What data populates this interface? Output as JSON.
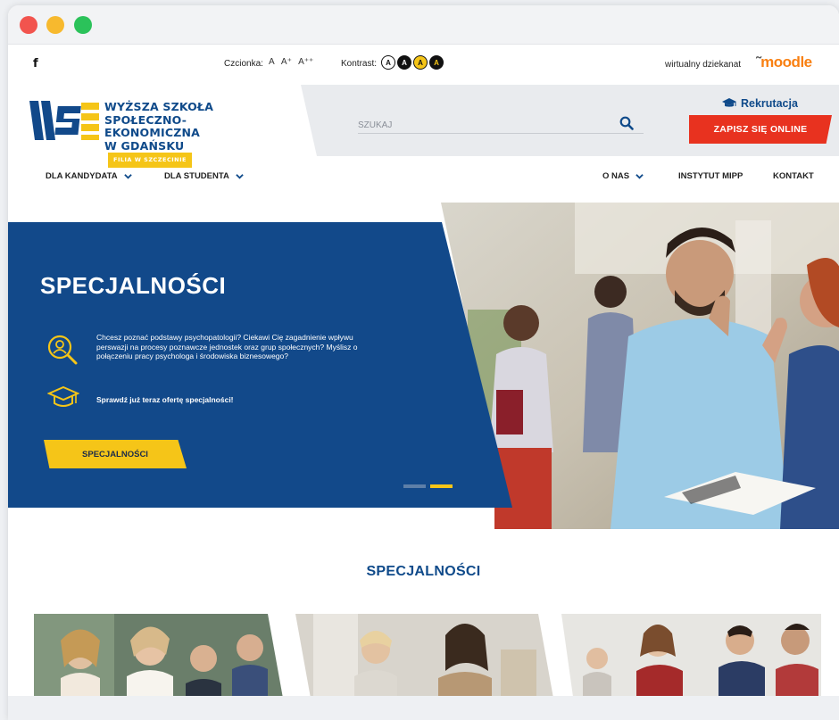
{
  "window": {
    "controls": [
      "close",
      "minimize",
      "maximize"
    ]
  },
  "topbar": {
    "facebook_icon": "f",
    "font_label": "Czcionka:",
    "font_sizes": [
      "A",
      "A⁺",
      "A⁺⁺"
    ],
    "contrast_label": "Kontrast:",
    "contrast_buttons": [
      "A",
      "A",
      "A",
      "A"
    ],
    "virtual_dean": "wirtualny dziekanat",
    "moodle": "moodle"
  },
  "logo": {
    "line1": "WYŻSZA SZKOŁA",
    "line2": "SPOŁECZNO-EKONOMICZNA",
    "line3": "W GDAŃSKU",
    "tag": "FILIA W SZCZECINIE"
  },
  "search": {
    "placeholder": "SZUKAJ"
  },
  "header_actions": {
    "rekrutacja": "Rekrutacja",
    "zapisz": "ZAPISZ SIĘ ONLINE"
  },
  "nav": {
    "left": [
      "DLA KANDYDATA",
      "DLA STUDENTA"
    ],
    "right_dropdown": "O NAS",
    "right_links": [
      "INSTYTUT MIPP",
      "KONTAKT"
    ]
  },
  "hero": {
    "title": "SPECJALNOŚCI",
    "feature1": "Chcesz poznać podstawy psychopatologii? Ciekawi Cię zagadnienie wpływu perswazji na procesy poznawcze jednostek oraz grup społecznych? Myślisz o połączeniu pracy psychologa i środowiska biznesowego?",
    "feature2": "Sprawdź już teraz ofertę specjalności!",
    "button": "SPECJALNOŚCI",
    "slides_total": 2,
    "active_slide": 2
  },
  "section": {
    "title": "SPECJALNOŚCI"
  },
  "colors": {
    "brand_blue": "#12498a",
    "accent_yellow": "#f5c518",
    "cta_red": "#e8321f",
    "moodle_orange": "#f98012"
  }
}
